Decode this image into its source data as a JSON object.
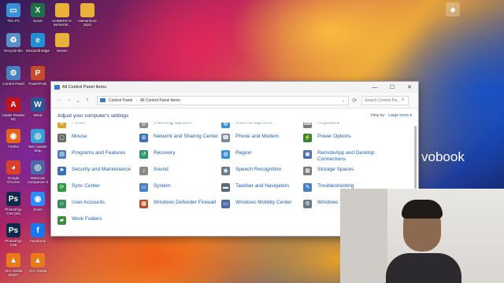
{
  "desktop": {
    "icons": [
      {
        "label": "This PC",
        "glyph": "▭",
        "color": "#3a8fd9"
      },
      {
        "label": "Excel",
        "glyph": "X",
        "color": "#1e7145"
      },
      {
        "label": "KHMERS S-INFINITE...",
        "glyph": "",
        "color": "#e8b23a"
      },
      {
        "label": "Hemenhore 2022",
        "glyph": "",
        "color": "#e8b23a"
      },
      {
        "label": "Recycle Bin",
        "glyph": "♻",
        "color": "#5a8fc8"
      },
      {
        "label": "Microsoft Edge",
        "glyph": "e",
        "color": "#1f8fd6"
      },
      {
        "label": "MAMA",
        "glyph": "",
        "color": "#e8b23a"
      },
      {
        "label": "Control Panel",
        "glyph": "⚙",
        "color": "#4a7fc0"
      },
      {
        "label": "PowerPoint",
        "glyph": "P",
        "color": "#c94a2a"
      },
      {
        "label": "Adobe Reader DC",
        "glyph": "A",
        "color": "#c0141a"
      },
      {
        "label": "Word",
        "glyph": "W",
        "color": "#2b5797"
      },
      {
        "label": "Firefox",
        "glyph": "◉",
        "color": "#e8641a"
      },
      {
        "label": "Win Update Stop",
        "glyph": "◎",
        "color": "#3aa0d8"
      },
      {
        "label": "Google Chrome",
        "glyph": "◕",
        "color": "#d9402e"
      },
      {
        "label": "WebCam Companion 5",
        "glyph": "◎",
        "color": "#4a6aa8"
      },
      {
        "label": "Photoshop CS6 (64)",
        "glyph": "Ps",
        "color": "#0e2a4a"
      },
      {
        "label": "Zoom",
        "glyph": "◉",
        "color": "#2d8cff"
      },
      {
        "label": "Photoshop CS6",
        "glyph": "Ps",
        "color": "#0e2a4a"
      },
      {
        "label": "Facebook",
        "glyph": "f",
        "color": "#1877f2"
      },
      {
        "label": "VLC media player",
        "glyph": "▲",
        "color": "#e87a1a"
      },
      {
        "label": "VLC media",
        "glyph": "▲",
        "color": "#e87a1a"
      }
    ]
  },
  "window": {
    "title": "All Control Panel Items",
    "controls": {
      "minimize": "—",
      "maximize": "☐",
      "close": "✕"
    },
    "nav": {
      "back": "←",
      "forward": "→",
      "recent": "⌄",
      "up": "↑"
    },
    "address": {
      "crumb1": "Control Panel",
      "sep": "›",
      "crumb2": "All Control Panel Items",
      "dropdown": "⌄"
    },
    "refresh": "⟳",
    "search_placeholder": "Search Control Pa...",
    "search_icon": "⌕",
    "heading": "Adjust your computer's settings",
    "view_by_label": "View by:",
    "view_by_value": "Large icons ▾",
    "items": [
      {
        "label": "Fonts",
        "icon": "font-icon",
        "color": "#e0a020",
        "glyph": "A"
      },
      {
        "label": "Indexing Options",
        "icon": "indexing-icon",
        "color": "#8c8c8c",
        "glyph": "◎"
      },
      {
        "label": "Internet Options",
        "icon": "globe-icon",
        "color": "#3a8fd9",
        "glyph": "◍"
      },
      {
        "label": "Keyboard",
        "icon": "keyboard-icon",
        "color": "#7a7a7a",
        "glyph": "⌨"
      },
      {
        "label": "Mouse",
        "icon": "mouse-icon",
        "color": "#6a6a6a",
        "glyph": "▢"
      },
      {
        "label": "Network and Sharing Center",
        "icon": "network-icon",
        "color": "#3a6fb8",
        "glyph": "⊞"
      },
      {
        "label": "Phone and Modem",
        "icon": "phone-icon",
        "color": "#7a8a9a",
        "glyph": "☎"
      },
      {
        "label": "Power Options",
        "icon": "power-icon",
        "color": "#2f8a3a",
        "glyph": "⚡"
      },
      {
        "label": "Programs and Features",
        "icon": "programs-icon",
        "color": "#4a7fc0",
        "glyph": "▤"
      },
      {
        "label": "Recovery",
        "icon": "recovery-icon",
        "color": "#2a9a6a",
        "glyph": "↺"
      },
      {
        "label": "Region",
        "icon": "region-icon",
        "color": "#3a8fd9",
        "glyph": "◍"
      },
      {
        "label": "RemoteApp and Desktop Connections",
        "icon": "remoteapp-icon",
        "color": "#4a6aa8",
        "glyph": "▣"
      },
      {
        "label": "Security and Maintenance",
        "icon": "flag-icon",
        "color": "#3a6fb8",
        "glyph": "⚑"
      },
      {
        "label": "Sound",
        "icon": "speaker-icon",
        "color": "#8a8a8a",
        "glyph": "♪"
      },
      {
        "label": "Speech Recognition",
        "icon": "microphone-icon",
        "color": "#6a7a8a",
        "glyph": "◉"
      },
      {
        "label": "Storage Spaces",
        "icon": "storage-icon",
        "color": "#7a7a7a",
        "glyph": "▦"
      },
      {
        "label": "Sync Center",
        "icon": "sync-icon",
        "color": "#2f9a3a",
        "glyph": "⟳"
      },
      {
        "label": "System",
        "icon": "system-icon",
        "color": "#4a7fc0",
        "glyph": "▭"
      },
      {
        "label": "Taskbar and Navigation",
        "icon": "taskbar-icon",
        "color": "#5a6a7a",
        "glyph": "▬"
      },
      {
        "label": "Troubleshooting",
        "icon": "troubleshoot-icon",
        "color": "#4a7fc0",
        "glyph": "✎"
      },
      {
        "label": "User Accounts",
        "icon": "users-icon",
        "color": "#3a8f5a",
        "glyph": "☺"
      },
      {
        "label": "Windows Defender Firewall",
        "icon": "firewall-icon",
        "color": "#b8502a",
        "glyph": "▦"
      },
      {
        "label": "Windows Mobility Center",
        "icon": "mobility-icon",
        "color": "#4a6aa8",
        "glyph": "▭"
      },
      {
        "label": "Windows Tools",
        "icon": "tools-icon",
        "color": "#6a7a8a",
        "glyph": "⚙"
      },
      {
        "label": "Work Folders",
        "icon": "folder-icon",
        "color": "#3a8f3a",
        "glyph": "▰"
      }
    ]
  },
  "wallpaper_brand": "vobook"
}
